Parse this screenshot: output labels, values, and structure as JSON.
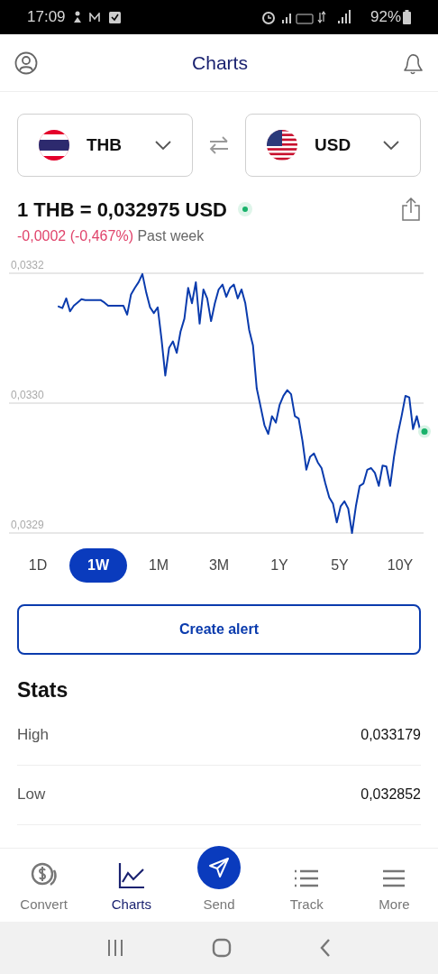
{
  "status_bar": {
    "time": "17:09",
    "battery": "92%"
  },
  "header": {
    "title": "Charts"
  },
  "converter": {
    "from": {
      "code": "THB"
    },
    "to": {
      "code": "USD"
    }
  },
  "rate": {
    "text": "1 THB = 0,032975 USD",
    "live": true,
    "change": "-0,0002 (-0,467%)",
    "period": "Past week"
  },
  "chart_data": {
    "type": "line",
    "yticks": [
      {
        "value": 0.03318,
        "label": "0,0332"
      },
      {
        "value": 0.03302,
        "label": "0,0330"
      },
      {
        "value": 0.03286,
        "label": "0,0329"
      }
    ],
    "ylim": [
      0.03286,
      0.03318
    ],
    "series": [
      {
        "color": "#0a3bad",
        "values": [
          0.033139,
          0.033137,
          0.033149,
          0.033133,
          0.03314,
          0.033144,
          0.033148,
          0.033147,
          0.033147,
          0.033147,
          0.033147,
          0.033147,
          0.033144,
          0.03314,
          0.03314,
          0.03314,
          0.03314,
          0.03314,
          0.033129,
          0.033154,
          0.033162,
          0.033169,
          0.033179,
          0.033156,
          0.033138,
          0.033131,
          0.033138,
          0.033099,
          0.033054,
          0.033088,
          0.033096,
          0.033082,
          0.033108,
          0.033124,
          0.033162,
          0.033143,
          0.033169,
          0.033118,
          0.03316,
          0.033149,
          0.033121,
          0.033143,
          0.03316,
          0.033166,
          0.033151,
          0.033162,
          0.033166,
          0.033149,
          0.03316,
          0.033143,
          0.03311,
          0.033091,
          0.033038,
          0.033016,
          0.032993,
          0.032982,
          0.033004,
          0.032996,
          0.033018,
          0.033029,
          0.033036,
          0.033031,
          0.033004,
          0.033001,
          0.032973,
          0.032938,
          0.032954,
          0.032958,
          0.032947,
          0.03294,
          0.032921,
          0.032904,
          0.032896,
          0.032873,
          0.032893,
          0.032899,
          0.03289,
          0.03286,
          0.032893,
          0.032918,
          0.032921,
          0.032938,
          0.03294,
          0.032934,
          0.032918,
          0.032943,
          0.032942,
          0.032918,
          0.032954,
          0.032982,
          0.033004,
          0.033029,
          0.033027,
          0.032988,
          0.033004,
          0.032984,
          0.032985
        ]
      }
    ]
  },
  "ranges": [
    {
      "label": "1D",
      "selected": false
    },
    {
      "label": "1W",
      "selected": true
    },
    {
      "label": "1M",
      "selected": false
    },
    {
      "label": "3M",
      "selected": false
    },
    {
      "label": "1Y",
      "selected": false
    },
    {
      "label": "5Y",
      "selected": false
    },
    {
      "label": "10Y",
      "selected": false
    }
  ],
  "alert_button": "Create alert",
  "stats": {
    "title": "Stats",
    "rows": [
      {
        "label": "High",
        "value": "0,033179"
      },
      {
        "label": "Low",
        "value": "0,032852"
      }
    ]
  },
  "nav": [
    {
      "label": "Convert",
      "selected": false
    },
    {
      "label": "Charts",
      "selected": true
    },
    {
      "label": "Send",
      "selected": false
    },
    {
      "label": "Track",
      "selected": false
    },
    {
      "label": "More",
      "selected": false
    }
  ]
}
